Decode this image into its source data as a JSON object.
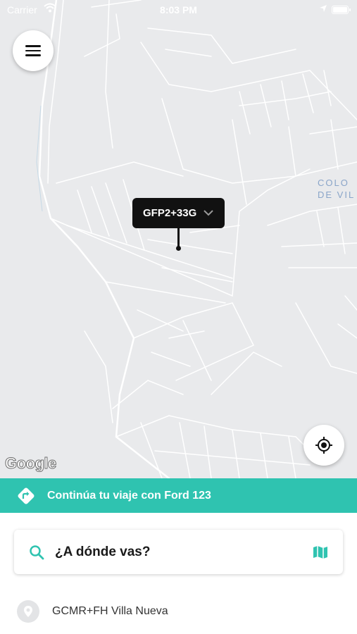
{
  "status_bar": {
    "carrier": "Carrier",
    "time": "8:03 PM"
  },
  "map": {
    "area_label_line1": "COLO",
    "area_label_line2": "DE VIL",
    "pin_code": "GFP2+33G",
    "attribution": "Google"
  },
  "banner": {
    "text": "Continúa tu viaje con Ford 123",
    "color": "#2fc3b0"
  },
  "search": {
    "prompt": "¿A dónde vas?",
    "icon": "search-icon",
    "map_icon": "map-icon"
  },
  "recent": {
    "label": "GCMR+FH Villa Nueva",
    "icon": "location-pin-icon"
  },
  "colors": {
    "accent": "#2fc3b0",
    "map_bg": "#e9eaec",
    "tooltip_bg": "#111111"
  }
}
